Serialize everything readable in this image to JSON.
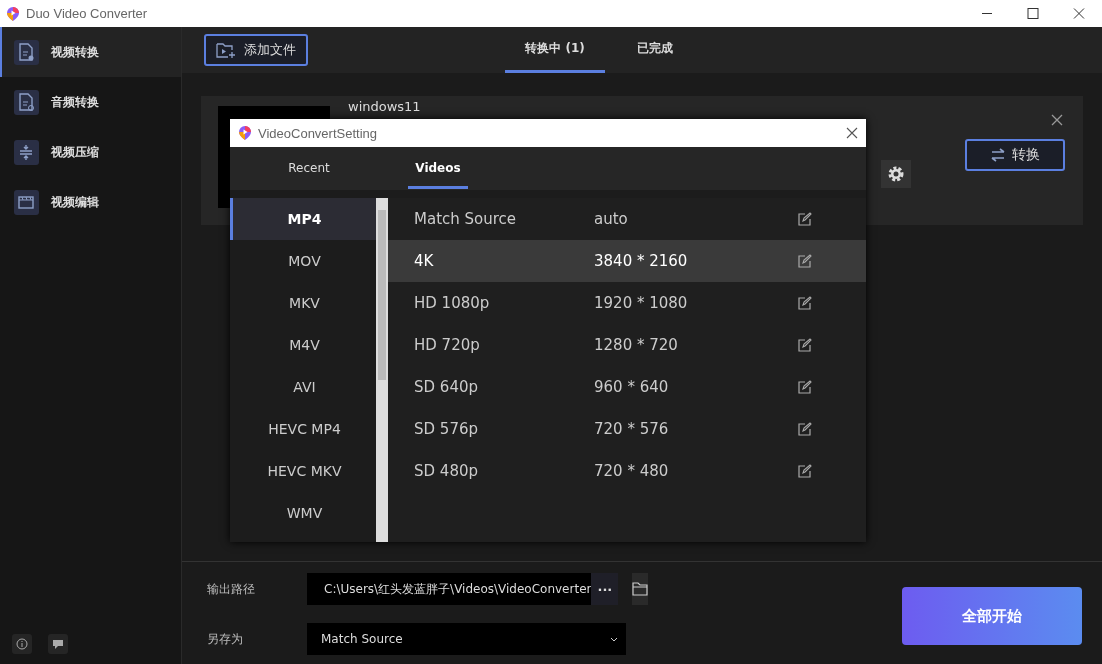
{
  "window": {
    "title": "Duo Video Converter"
  },
  "sidebar": {
    "items": [
      {
        "label": "视频转换",
        "selected": true
      },
      {
        "label": "音频转换",
        "selected": false
      },
      {
        "label": "视频压缩",
        "selected": false
      },
      {
        "label": "视频编辑",
        "selected": false
      }
    ]
  },
  "toolbar": {
    "add_button": "添加文件"
  },
  "tabs": [
    {
      "label": "转换中 (1)",
      "selected": true
    },
    {
      "label": "已完成",
      "selected": false
    }
  ],
  "file_card": {
    "name": "windows11",
    "convert_button": "转换"
  },
  "output": {
    "path_label": "输出路径",
    "path": "C:\\Users\\红头发蓝胖子\\Videos\\VideoConverter",
    "more_button": "···",
    "save_label": "另存为",
    "save_as": "Match Source",
    "start_button": "全部开始"
  },
  "dialog": {
    "title": "VideoConvertSetting",
    "tabs": [
      {
        "label": "Recent",
        "selected": false
      },
      {
        "label": "Videos",
        "selected": true
      }
    ],
    "formats": [
      {
        "label": "MP4",
        "selected": true
      },
      {
        "label": "MOV",
        "selected": false
      },
      {
        "label": "MKV",
        "selected": false
      },
      {
        "label": "M4V",
        "selected": false
      },
      {
        "label": "AVI",
        "selected": false
      },
      {
        "label": "HEVC MP4",
        "selected": false
      },
      {
        "label": "HEVC MKV",
        "selected": false
      },
      {
        "label": "WMV",
        "selected": false
      }
    ],
    "presets": [
      {
        "name": "Match Source",
        "resolution": "auto",
        "selected": false
      },
      {
        "name": "4K",
        "resolution": "3840 * 2160",
        "selected": true
      },
      {
        "name": "HD 1080p",
        "resolution": "1920 * 1080",
        "selected": false
      },
      {
        "name": "HD 720p",
        "resolution": "1280 * 720",
        "selected": false
      },
      {
        "name": "SD 640p",
        "resolution": "960 * 640",
        "selected": false
      },
      {
        "name": "SD 576p",
        "resolution": "720 * 576",
        "selected": false
      },
      {
        "name": "SD 480p",
        "resolution": "720 * 480",
        "selected": false
      }
    ]
  }
}
